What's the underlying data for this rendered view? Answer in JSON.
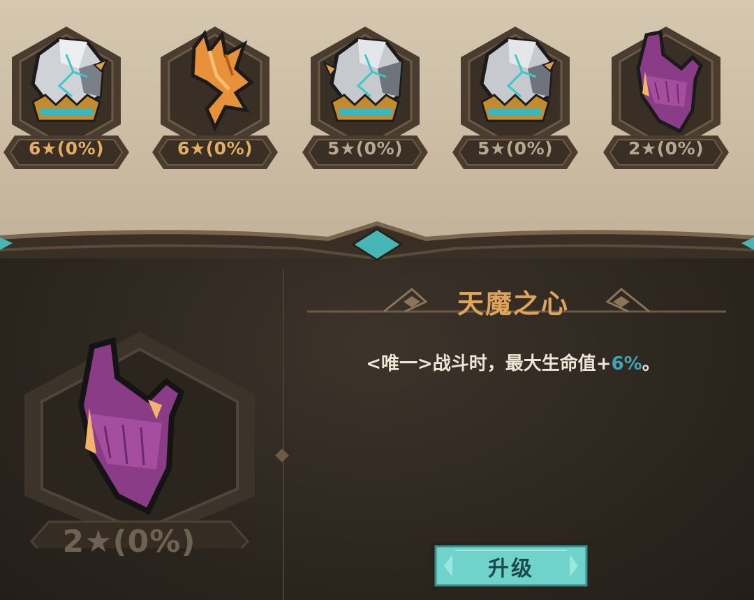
{
  "slots": [
    {
      "label": "6★(0%)",
      "item": "cracked-stone-crown-icon"
    },
    {
      "label": "6★(0%)",
      "item": "orange-claw-icon"
    },
    {
      "label": "5★(0%)",
      "item": "cracked-stone-crown-icon"
    },
    {
      "label": "5★(0%)",
      "item": "cracked-stone-crown-icon"
    },
    {
      "label": "2★(0%)",
      "item": "purple-demon-heart-icon"
    }
  ],
  "detail": {
    "item": "purple-demon-heart-icon",
    "stars_label": "2★(0%)",
    "title": "天魔之心",
    "desc_before": "<唯一>战斗时，最大生命值+",
    "desc_value": "6%",
    "desc_after": "。"
  },
  "upgrade_button": {
    "label": "升级"
  },
  "colors": {
    "gold_text": "#e3ad62",
    "dim_text": "#b6a891",
    "title": "#e0a35a",
    "highlight": "#3ea6b3",
    "button": "#6fd3cc",
    "frame": "#4a3c2f"
  }
}
